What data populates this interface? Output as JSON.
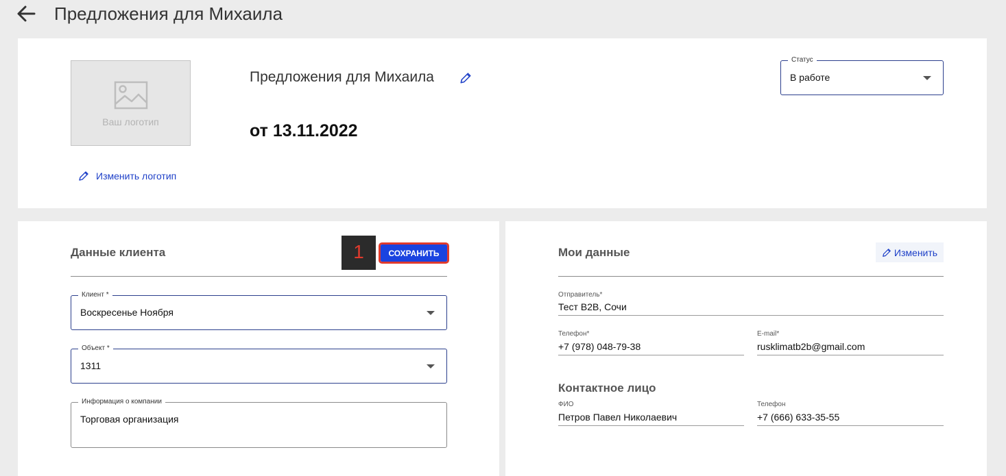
{
  "header": {
    "title": "Предложения для Михаила"
  },
  "logo": {
    "placeholder_text": "Ваш логотип",
    "change_label": "Изменить логотип"
  },
  "offer": {
    "title": "Предложения для Михаила",
    "date": "от 13.11.2022"
  },
  "status": {
    "label": "Статус",
    "value": "В работе"
  },
  "client_section": {
    "title": "Данные клиента",
    "step_number": "1",
    "save_label": "СОХРАНИТЬ",
    "client": {
      "label": "Клиент *",
      "value": "Воскресенье Ноября"
    },
    "object": {
      "label": "Объект *",
      "value": "1311"
    },
    "company_info": {
      "label": "Информация о компании",
      "value": "Торговая организация"
    }
  },
  "my_data": {
    "title": "Мои данные",
    "edit_label": "Изменить",
    "sender": {
      "label": "Отправитель*",
      "value": "Тест B2B, Сочи"
    },
    "phone": {
      "label": "Телефон*",
      "value": "+7 (978) 048-79-38"
    },
    "email": {
      "label": "E-mail*",
      "value": "rusklimatb2b@gmail.com"
    },
    "contact_title": "Контактное лицо",
    "contact_name": {
      "label": "ФИО",
      "value": "Петров Павел Николаевич"
    },
    "contact_phone": {
      "label": "Телефон",
      "value": "+7 (666) 633-35-55"
    }
  },
  "colors": {
    "accent": "#1a43e0",
    "link": "#1e40c8",
    "highlight": "#e03a2d",
    "field_border": "#2a3e8c"
  },
  "icons": {
    "back": "arrow-left-icon",
    "image": "image-placeholder-icon",
    "edit": "pencil-icon",
    "dropdown": "caret-down-icon"
  }
}
